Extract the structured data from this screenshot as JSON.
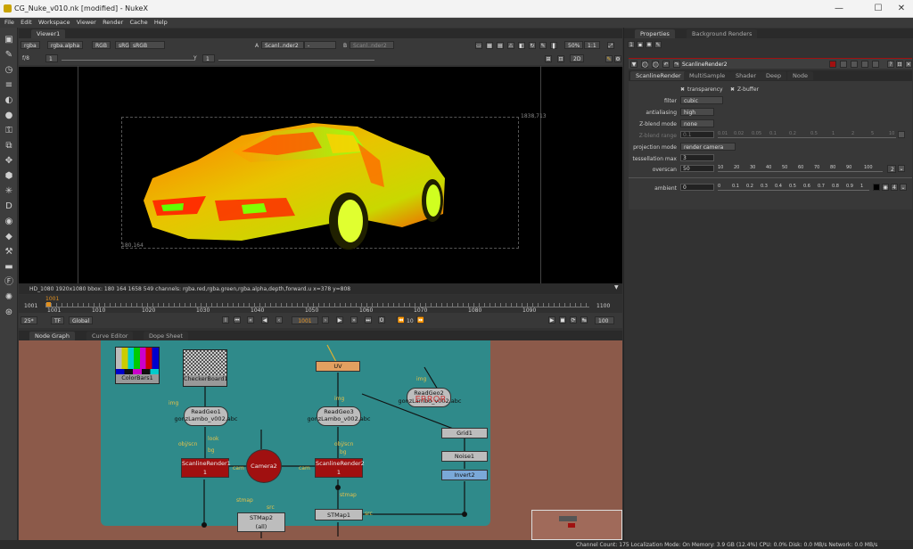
{
  "window": {
    "title": "CG_Nuke_v010.nk [modified] - NukeX",
    "minimize": "—",
    "maximize": "☐",
    "close": "✕"
  },
  "menu": [
    "File",
    "Edit",
    "Workspace",
    "Viewer",
    "Render",
    "Cache",
    "Help"
  ],
  "left_toolbar_icons": [
    "image-icon",
    "draw-icon",
    "time-icon",
    "channel-icon",
    "color-icon",
    "filter-icon",
    "keyer-icon",
    "merge-icon",
    "transform-icon",
    "3d-icon",
    "particles-icon",
    "deep-icon",
    "views-icon",
    "metadata-icon",
    "toolsets-icon",
    "other-icon",
    "furnace-icon",
    "ocula-icon",
    "cara-icon"
  ],
  "viewer": {
    "tab_label": "Viewer1",
    "channels": "rgba",
    "alpha": "rgba.alpha",
    "display": "RGB",
    "lut_short": "sRGB",
    "colorspace": "sRGB",
    "input_a_label": "A",
    "input_a": "Scanl..nder2",
    "input_a_op": "-",
    "input_b_label": "B",
    "input_b": "Scanl..nder2",
    "zoom": "50%",
    "ratio": "1:1",
    "fstop_label": "f/8",
    "gain_value": "1",
    "y_label": "Y",
    "gamma_value": "1",
    "view_mode": "2D",
    "bbox_top_right": "1838,713",
    "bbox_bottom_left": "180,164",
    "info_text": "HD_1080 1920x1080  bbox: 180 164 1658 549 channels: rgba.red,rgba.green,rgba.alpha,depth,forward.u  x=378 y=808"
  },
  "timeline": {
    "start": "1001",
    "end": "1100",
    "current_marker": "1001",
    "ticks": [
      "1001",
      "1010",
      "1020",
      "1030",
      "1040",
      "1050",
      "1060",
      "1070",
      "1080",
      "1090",
      "1100"
    ],
    "fps": "25*",
    "tf": "TF",
    "scope": "Global",
    "frame_field": "1001",
    "step": "10",
    "end_field": "100"
  },
  "node_graph_tabs": [
    "Node Graph",
    "Curve Editor",
    "Dope Sheet"
  ],
  "nodes": {
    "colorbars": "ColorBars1",
    "checkerboard": "CheckerBoard1",
    "uv": "UV",
    "readgeo1": "ReadGeo1",
    "readgeo1_file": "gonzLambo_v002.abc",
    "readgeo3": "ReadGeo3",
    "readgeo3_file": "gonzLambo_v002.abc",
    "readgeo2": "ReadGeo2",
    "readgeo2_file": "gonzLambo_v002.abc",
    "readgeo2_error": "ERROR",
    "camera": "Camera2",
    "scanline1_a": "ScanlineRender1",
    "scanline1_b": "1",
    "scanline2_a": "ScanlineRender2",
    "scanline2_b": "1",
    "grid": "Grid1",
    "noise": "Noise1",
    "invert": "Invert2",
    "stmap1": "STMap1",
    "stmap2_a": "STMap2",
    "stmap2_b": "(all)"
  },
  "pipe_labels": [
    "img",
    "img",
    "obj/scn",
    "look",
    "bg",
    "obj/scn",
    "bg",
    "cam",
    "cam",
    "stmap",
    "src",
    "stmap",
    "src",
    "img"
  ],
  "properties": {
    "tabs": [
      "Properties",
      "Background Renders"
    ],
    "node_name": "ScanlineRender2",
    "node_tabs": [
      "ScanlineRender",
      "MultiSample",
      "Shader",
      "Deep",
      "Node"
    ],
    "transparency": "transparency",
    "zbuffer": "Z-buffer",
    "filter_label": "filter",
    "filter_value": "cubic",
    "antialiasing_label": "antialiasing",
    "antialiasing_value": "high",
    "zblend_mode_label": "Z-blend mode",
    "zblend_mode_value": "none",
    "zblend_range_label": "Z-blend range",
    "zblend_range_value": "0.1",
    "zblend_ticks": [
      "0.01",
      "0.02",
      "0.05",
      "0.1",
      "0.2",
      "0.5",
      "1",
      "2",
      "5",
      "10"
    ],
    "projection_label": "projection mode",
    "projection_value": "render camera",
    "tessellation_label": "tessellation max",
    "tessellation_value": "3",
    "overscan_label": "overscan",
    "overscan_value": "50",
    "overscan_ticks": [
      "10",
      "20",
      "30",
      "40",
      "50",
      "60",
      "70",
      "80",
      "90",
      "100"
    ],
    "overscan_aux": "2",
    "ambient_label": "ambient",
    "ambient_value": "0",
    "ambient_ticks": [
      "0",
      "0.1",
      "0.2",
      "0.3",
      "0.4",
      "0.5",
      "0.6",
      "0.7",
      "0.8",
      "0.9",
      "1"
    ]
  },
  "status_bar": "Channel Count: 175  Localization Mode: On  Memory: 3.9 GB (12.4%)  CPU: 0.0%  Disk: 0.0 MB/s  Network: 0.0 MB/s"
}
